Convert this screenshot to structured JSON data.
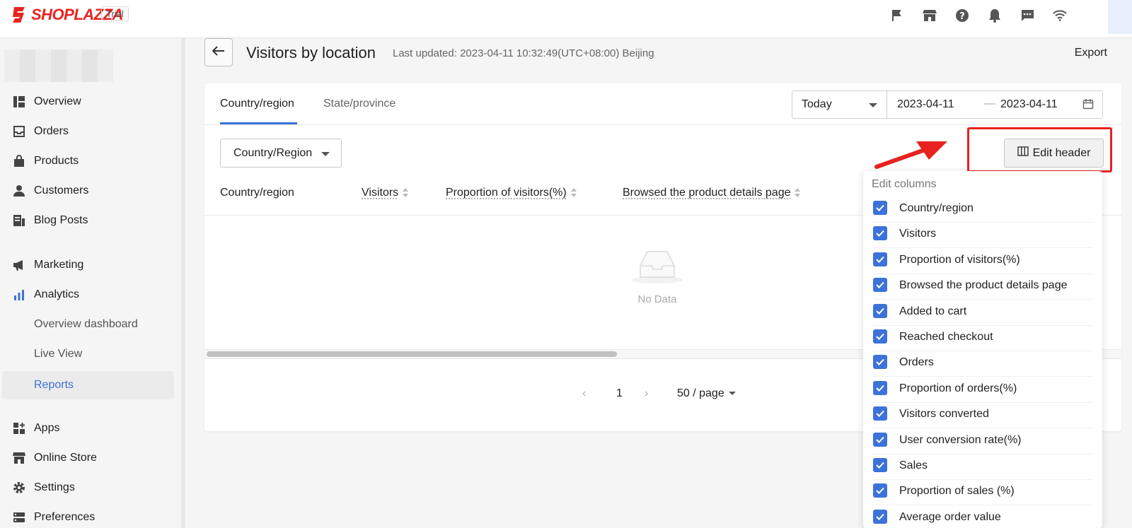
{
  "app": {
    "brand": "SHOPLAZZA",
    "plan_badge": "Trial"
  },
  "top_icons": [
    "flag-icon",
    "store-icon",
    "help-icon",
    "bell-icon",
    "message-icon",
    "wifi-icon"
  ],
  "sidebar": {
    "items": [
      {
        "label": "Overview",
        "icon": "overview-icon"
      },
      {
        "label": "Orders",
        "icon": "orders-icon"
      },
      {
        "label": "Products",
        "icon": "products-icon"
      },
      {
        "label": "Customers",
        "icon": "customers-icon"
      },
      {
        "label": "Blog Posts",
        "icon": "blog-icon"
      },
      {
        "label": "Marketing",
        "icon": "megaphone-icon"
      },
      {
        "label": "Analytics",
        "icon": "analytics-icon"
      },
      {
        "label": "Overview dashboard"
      },
      {
        "label": "Live View"
      },
      {
        "label": "Reports"
      },
      {
        "label": "Apps",
        "icon": "apps-icon"
      },
      {
        "label": "Online Store",
        "icon": "store-icon"
      },
      {
        "label": "Settings",
        "icon": "gear-icon"
      },
      {
        "label": "Preferences",
        "icon": "preferences-icon"
      }
    ],
    "active": "Reports"
  },
  "header": {
    "title": "Visitors by location",
    "last_updated": "Last updated: 2023-04-11 10:32:49(UTC+08:00) Beijing",
    "export": "Export"
  },
  "tabs": [
    {
      "label": "Country/region"
    },
    {
      "label": "State/province"
    }
  ],
  "date_range": {
    "preset": "Today",
    "from": "2023-04-11",
    "separator": "—",
    "to": "2023-04-11"
  },
  "filter": {
    "dimension": "Country/Region"
  },
  "edit_header_label": "Edit header",
  "table": {
    "columns": [
      "Country/region",
      "Visitors",
      "Proportion of visitors(%)",
      "Browsed the product details page"
    ],
    "empty_text": "No Data"
  },
  "pagination": {
    "prev": "‹",
    "current": "1",
    "next": "›",
    "page_size": "50 / page"
  },
  "edit_columns": {
    "title": "Edit columns",
    "items": [
      {
        "label": "Country/region",
        "checked": true
      },
      {
        "label": "Visitors",
        "checked": true
      },
      {
        "label": "Proportion of visitors(%)",
        "checked": true
      },
      {
        "label": "Browsed the product details page",
        "checked": true
      },
      {
        "label": "Added to cart",
        "checked": true
      },
      {
        "label": "Reached checkout",
        "checked": true
      },
      {
        "label": "Orders",
        "checked": true
      },
      {
        "label": "Proportion of orders(%)",
        "checked": true
      },
      {
        "label": "Visitors converted",
        "checked": true
      },
      {
        "label": "User conversion rate(%)",
        "checked": true
      },
      {
        "label": "Sales",
        "checked": true
      },
      {
        "label": "Proportion of sales (%)",
        "checked": true
      },
      {
        "label": "Average order value",
        "checked": true
      }
    ]
  },
  "colors": {
    "accent": "#3c72d9",
    "brand": "#e8231f",
    "highlight": "#e8231f"
  }
}
